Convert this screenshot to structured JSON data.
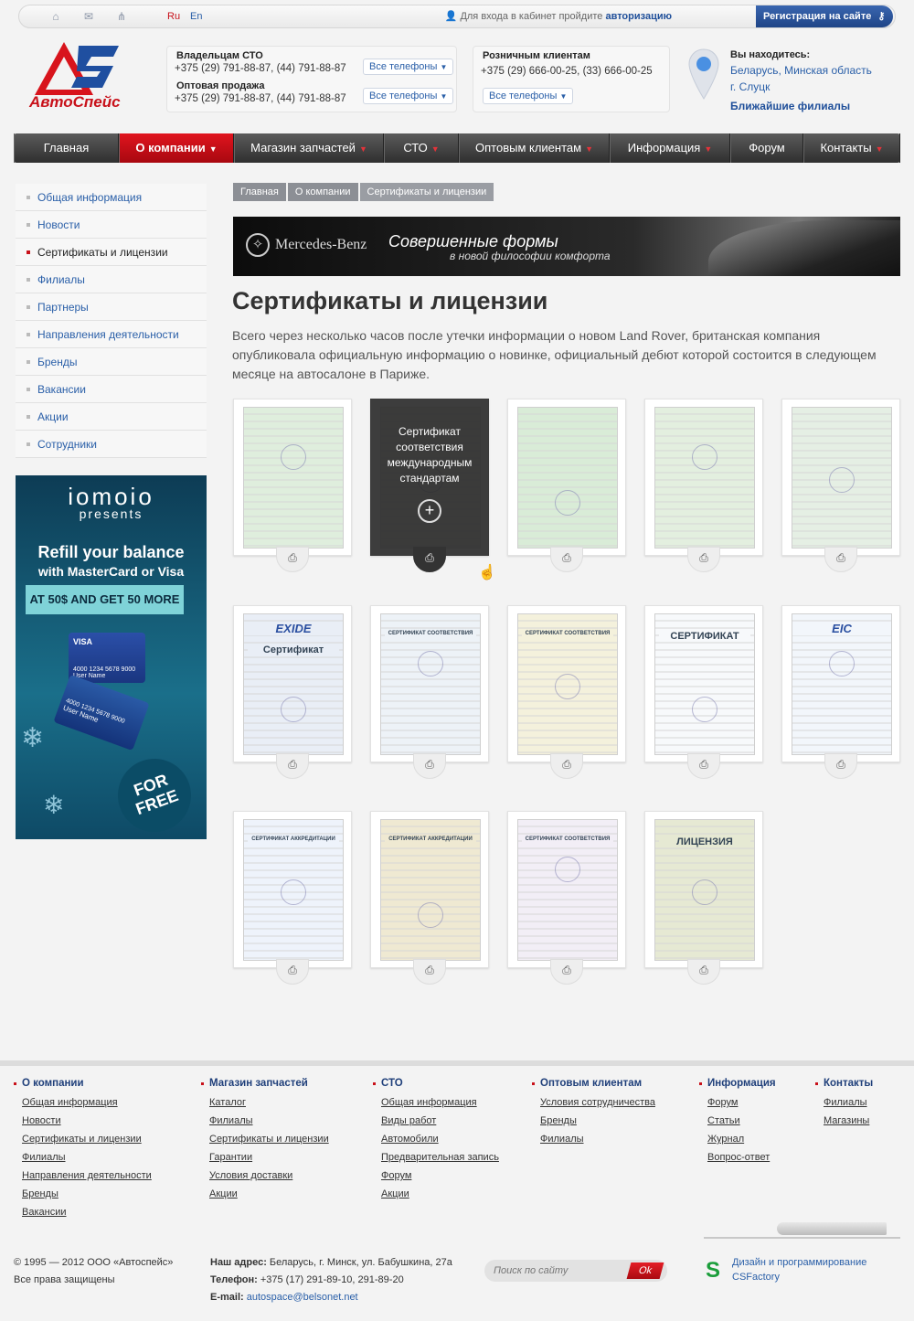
{
  "topbar": {
    "icons": [
      "home-icon",
      "mail-icon",
      "sitemap-icon"
    ],
    "lang_ru": "Ru",
    "lang_en": "En",
    "login_prefix": "Для входа в кабинет пройдите",
    "login_link": "авторизацию",
    "register_label": "Регистрация на сайте"
  },
  "logo": {
    "text": "АвтоСпейс"
  },
  "contacts": {
    "sto": {
      "title": "Владельцам СТО",
      "phone": "+375 (29) 791-88-87, (44) 791-88-87",
      "wholesale_title": "Оптовая продажа",
      "wholesale_phone": "+375 (29) 791-88-87, (44) 791-88-87",
      "all_phones": "Все телефоны"
    },
    "retail": {
      "title": "Розничным клиентам",
      "phone": "+375 (29) 666-00-25, (33) 666-00-25",
      "all_phones": "Все телефоны"
    },
    "location": {
      "title": "Вы находитесь:",
      "region": "Беларусь, Минская область",
      "city": "г. Слуцк",
      "nearest": "Ближайшие филиалы"
    }
  },
  "nav": [
    {
      "label": "Главная",
      "caret": false
    },
    {
      "label": "О компании",
      "caret": true,
      "active": true
    },
    {
      "label": "Магазин запчастей",
      "caret": true
    },
    {
      "label": "СТО",
      "caret": true
    },
    {
      "label": "Оптовым клиентам",
      "caret": true
    },
    {
      "label": "Информация",
      "caret": true
    },
    {
      "label": "Форум",
      "caret": false
    },
    {
      "label": "Контакты",
      "caret": true
    }
  ],
  "sidebar": [
    {
      "label": "Общая информация"
    },
    {
      "label": "Новости"
    },
    {
      "label": "Сертификаты и лицензии",
      "active": true
    },
    {
      "label": "Филиалы"
    },
    {
      "label": "Партнеры"
    },
    {
      "label": "Направления деятельности"
    },
    {
      "label": "Бренды"
    },
    {
      "label": "Вакансии"
    },
    {
      "label": "Акции"
    },
    {
      "label": "Сотрудники"
    }
  ],
  "ad": {
    "brand": "iomoio",
    "presents": "presents",
    "line1": "Refill your balance",
    "line2": "with MasterCard or Visa",
    "offer": "AT 50$ AND GET 50 MORE",
    "card_visa": "VISA",
    "card_number": "4000 1234 5678 9000",
    "card_user": "User Name",
    "badge": "FOR FREE"
  },
  "breadcrumbs": [
    "Главная",
    "О компании",
    "Сертификаты и лицензии"
  ],
  "banner": {
    "brand": "Mercedes-Benz",
    "headline": "Совершенные формы",
    "subline": "в новой философии комфорта"
  },
  "page": {
    "title": "Сертификаты и лицензии",
    "intro": "Всего через несколько часов после утечки информации о новом Land Rover, британская компания опубликовала официальную информацию о новинке, официальный дебют которой состоится в следующем месяце на автосалоне в Париже."
  },
  "certificates": {
    "hover_caption": "Сертификат соответствия международным стандартам",
    "items": [
      {
        "tint": "#dfeedd",
        "heading": ""
      },
      {
        "tint": "#e8e8e0",
        "heading": "",
        "hovered": true
      },
      {
        "tint": "#d9ecd7",
        "heading": ""
      },
      {
        "tint": "#e3efdf",
        "heading": ""
      },
      {
        "tint": "#e5efe4",
        "heading": ""
      },
      {
        "tint": "#e9eef6",
        "heading": "Сертификат",
        "logo": "EXIDE"
      },
      {
        "tint": "#edf2f7",
        "heading": "СЕРТИФИКАТ СООТВЕТСТВИЯ"
      },
      {
        "tint": "#f4f1dc",
        "heading": "СЕРТИФИКАТ СООТВЕТСТВИЯ"
      },
      {
        "tint": "#f7f9fb",
        "heading": "СЕРТИФИКАТ"
      },
      {
        "tint": "#f2f6fb",
        "heading": "",
        "logo": "EIC"
      },
      {
        "tint": "#eef3fb",
        "heading": "СЕРТИФИКАТ АККРЕДИТАЦИИ"
      },
      {
        "tint": "#efe9d2",
        "heading": "СЕРТИФИКАТ АККРЕДИТАЦИИ"
      },
      {
        "tint": "#f2eef6",
        "heading": "СЕРТИФИКАТ СООТВЕТСТВИЯ"
      },
      {
        "tint": "#e6e9d3",
        "heading": "ЛИЦЕНЗИЯ"
      }
    ]
  },
  "footer": {
    "columns": [
      {
        "title": "О компании",
        "links": [
          "Общая информация",
          "Новости",
          "Сертификаты и лицензии",
          "Филиалы",
          "Направления деятельности",
          "Бренды",
          "Вакансии"
        ]
      },
      {
        "title": "Магазин запчастей",
        "links": [
          "Каталог",
          "Филиалы",
          "Сертификаты и лицензии",
          "Гарантии",
          "Условия доставки",
          "Акции"
        ]
      },
      {
        "title": "СТО",
        "links": [
          "Общая информация",
          "Виды работ",
          "Автомобили",
          "Предварительная запись",
          "Форум",
          "Акции"
        ]
      },
      {
        "title": "Оптовым клиентам",
        "links": [
          "Условия сотрудничества",
          "Бренды",
          "Филиалы"
        ]
      },
      {
        "title": "Информация",
        "links": [
          "Форум",
          "Статьи",
          "Журнал",
          "Вопрос-ответ"
        ]
      },
      {
        "title": "Контакты",
        "links": [
          "Филиалы",
          "Магазины"
        ]
      }
    ],
    "copyright": "© 1995 — 2012 ООО «Автоспейс»",
    "rights": "Все права защищены",
    "address_label": "Наш адрес:",
    "address": "Беларусь, г. Минск, ул. Бабушкина, 27а",
    "phone_label": "Телефон:",
    "phone": "+375 (17) 291-89-10, 291-89-20",
    "email_label": "E-mail:",
    "email": "autospace@belsonet.net",
    "search_placeholder": "Поиск по сайту",
    "search_button": "Ok",
    "design_line1": "Дизайн и программирование",
    "design_line2": "CSFactory"
  },
  "colors": {
    "accent_red": "#c8111a",
    "link_blue": "#2a5fa8",
    "nav_dark": "#3a3a3a"
  }
}
